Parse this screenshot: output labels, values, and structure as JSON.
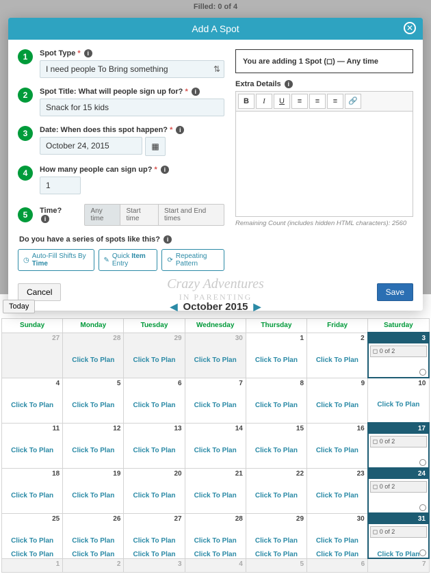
{
  "bg_filled": "Filled: 0 of 4",
  "modal": {
    "title": "Add A Spot",
    "steps": {
      "1": {
        "label": "Spot Type",
        "value": "I need people To Bring something"
      },
      "2": {
        "label": "Spot Title: What will people sign up for?",
        "value": "Snack for 15 kids"
      },
      "3": {
        "label": "Date: When does this spot happen?",
        "value": "October 24, 2015"
      },
      "4": {
        "label": "How many people can sign up?",
        "value": "1"
      },
      "5": {
        "label": "Time?",
        "options": [
          "Any time",
          "Start time",
          "Start and End times"
        ]
      }
    },
    "series_q": "Do you have a series of spots like this?",
    "chips": {
      "autofill": "Auto-Fill Shifts By Time",
      "quick": "Quick Item Entry",
      "repeat": "Repeating Pattern"
    },
    "summary": "You are adding 1 Spot (◻) — Any time",
    "extra_label": "Extra Details",
    "remaining": "Remaining Count (includes hidden HTML characters): 2560",
    "cancel": "Cancel",
    "save": "Save"
  },
  "watermark": {
    "l1": "Crazy Adventures",
    "l2": "IN PARENTING"
  },
  "calendar": {
    "today": "Today",
    "title": "October 2015",
    "dow": [
      "Sunday",
      "Monday",
      "Tuesday",
      "Wednesday",
      "Thursday",
      "Friday",
      "Saturday"
    ],
    "click": "Click To Plan",
    "spot_label": "◻ 0 of 2"
  }
}
